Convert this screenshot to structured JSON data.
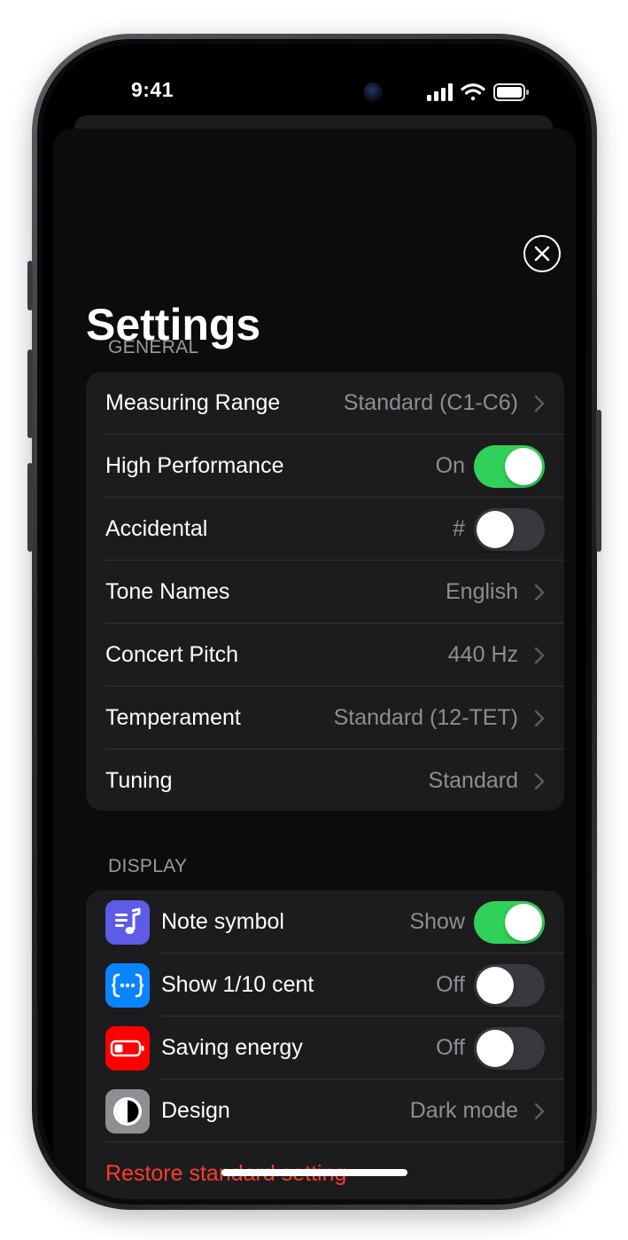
{
  "status_bar": {
    "time": "9:41"
  },
  "header": {
    "title": "Settings",
    "close_icon": "close-circle-icon"
  },
  "general": {
    "section_label": "GENERAL",
    "rows": {
      "measuring_range": {
        "label": "Measuring Range",
        "value": "Standard (C1-C6)"
      },
      "high_performance": {
        "label": "High Performance",
        "value": "On",
        "toggle_on": true
      },
      "accidental": {
        "label": "Accidental",
        "value": "#",
        "toggle_on": false
      },
      "tone_names": {
        "label": "Tone Names",
        "value": "English"
      },
      "concert_pitch": {
        "label": "Concert Pitch",
        "value": "440 Hz"
      },
      "temperament": {
        "label": "Temperament",
        "value": "Standard (12-TET)"
      },
      "tuning": {
        "label": "Tuning",
        "value": "Standard"
      }
    }
  },
  "display": {
    "section_label": "DISPLAY",
    "rows": {
      "note_symbol": {
        "label": "Note symbol",
        "value": "Show",
        "toggle_on": true,
        "icon": "note-list-icon",
        "icon_color": "#5e5ce6"
      },
      "show_tenth_cent": {
        "label": "Show 1/10 cent",
        "value": "Off",
        "toggle_on": false,
        "icon": "braces-dots-icon",
        "icon_color": "#0a84ff"
      },
      "saving_energy": {
        "label": "Saving energy",
        "value": "Off",
        "toggle_on": false,
        "icon": "low-battery-icon",
        "icon_color": "#ff0000"
      },
      "design": {
        "label": "Design",
        "value": "Dark mode",
        "icon": "half-circle-icon",
        "icon_color": "#8e8e93"
      }
    },
    "restore_label": "Restore standard setting"
  },
  "colors": {
    "accent_green": "#30d158",
    "destructive_red": "#ff3b30",
    "background": "#000000",
    "group_background": "#1c1c1e"
  }
}
